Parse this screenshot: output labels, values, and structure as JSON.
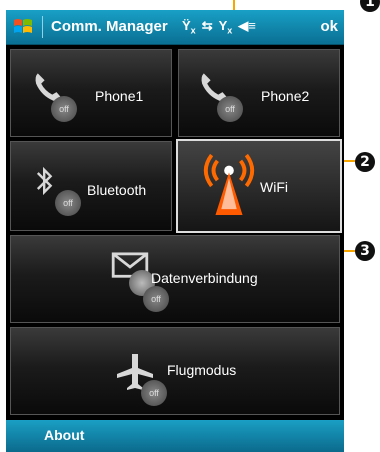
{
  "window": {
    "title": "Comm. Manager",
    "ok_label": "ok",
    "status_icons": [
      "phone-off-icon",
      "transfer-icon",
      "signal-off-icon",
      "volume-icon"
    ]
  },
  "tiles": {
    "phone1": {
      "label": "Phone1",
      "state": "off"
    },
    "phone2": {
      "label": "Phone2",
      "state": "off"
    },
    "bluetooth": {
      "label": "Bluetooth",
      "state": "off"
    },
    "wifi": {
      "label": "WiFi",
      "state": "on"
    },
    "data": {
      "label": "Datenverbindung",
      "state": "off"
    },
    "flight": {
      "label": "Flugmodus",
      "state": "off"
    }
  },
  "bottom": {
    "about_label": "About"
  },
  "callouts": {
    "c1": "1",
    "c2": "2",
    "c3": "3"
  },
  "colors": {
    "titlebar": "#0a6f93",
    "accent": "#ff6a00",
    "leader": "#f7a600"
  }
}
